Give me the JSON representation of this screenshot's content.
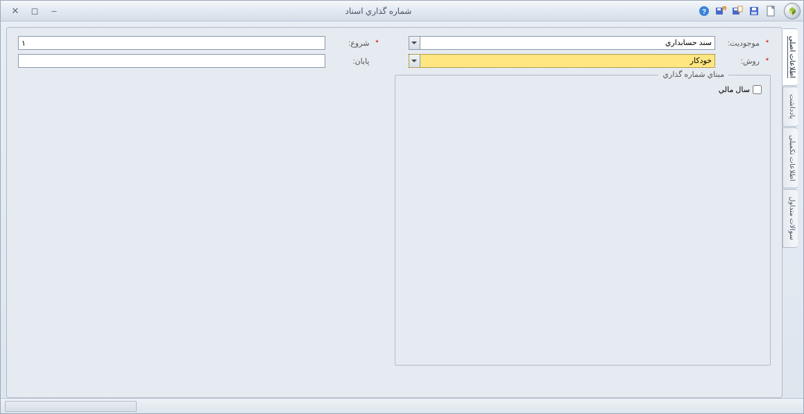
{
  "titlebar": {
    "title": "شماره گذاري اسناد"
  },
  "toolbar": {
    "new": "جدید",
    "save": "ذخیره",
    "save_new": "ذخیره و جدید",
    "save_close": "ذخیره و بستن",
    "help": "راهنما"
  },
  "window_controls": {
    "minimize": "_",
    "maximize": "□",
    "close": "x"
  },
  "tabs": {
    "t1": "اطلاعات اصلی",
    "t2": "یادداشت",
    "t3": "اطلاعات تکمیلی",
    "t4": "سوالات متداول"
  },
  "form": {
    "entity_label": "موجوديت:",
    "entity_value": "سند حسابداري",
    "method_label": "روش:",
    "method_value": "خودکار",
    "start_label": "شروع:",
    "start_value": "١",
    "end_label": "پايان:",
    "end_value": ""
  },
  "fieldset": {
    "legend": "مبناي شماره گذاري",
    "fiscal_year": "سال مالي"
  }
}
